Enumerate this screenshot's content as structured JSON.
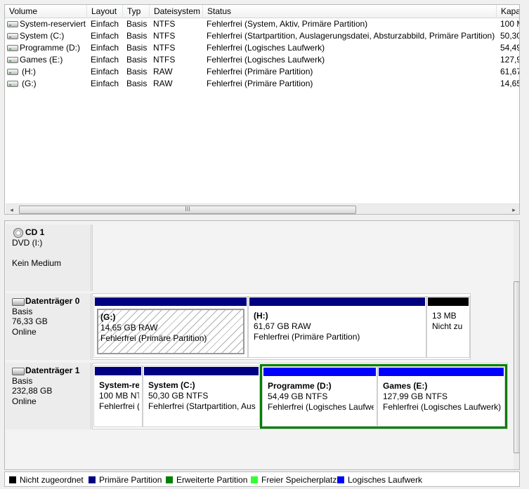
{
  "volume_list": {
    "columns": [
      "Volume",
      "Layout",
      "Typ",
      "Dateisystem",
      "Status",
      "Kapaz"
    ],
    "rows": [
      {
        "volume": "System-reserviert",
        "layout": "Einfach",
        "typ": "Basis",
        "fs": "NTFS",
        "status": "Fehlerfrei (System, Aktiv, Primäre Partition)",
        "kap": "100 M"
      },
      {
        "volume": "System (C:)",
        "layout": "Einfach",
        "typ": "Basis",
        "fs": "NTFS",
        "status": "Fehlerfrei (Startpartition, Auslagerungsdatei, Absturzabbild, Primäre Partition)",
        "kap": "50,30"
      },
      {
        "volume": "Programme (D:)",
        "layout": "Einfach",
        "typ": "Basis",
        "fs": "NTFS",
        "status": "Fehlerfrei (Logisches Laufwerk)",
        "kap": "54,49"
      },
      {
        "volume": "Games (E:)",
        "layout": "Einfach",
        "typ": "Basis",
        "fs": "NTFS",
        "status": "Fehlerfrei (Logisches Laufwerk)",
        "kap": "127,9"
      },
      {
        "volume": "(H:)",
        "layout": "Einfach",
        "typ": "Basis",
        "fs": "RAW",
        "status": "Fehlerfrei (Primäre Partition)",
        "kap": "61,67"
      },
      {
        "volume": "(G:)",
        "layout": "Einfach",
        "typ": "Basis",
        "fs": "RAW",
        "status": "Fehlerfrei (Primäre Partition)",
        "kap": "14,65"
      }
    ],
    "scroll_left_glyph": "◂",
    "scroll_right_glyph": "▸",
    "scroll_grip": "III"
  },
  "disks": {
    "cd1": {
      "name": "CD 1",
      "drive": "DVD (I:)",
      "state": "Kein Medium"
    },
    "disk0": {
      "name": "Datenträger 0",
      "type": "Basis",
      "size": "76,33 GB",
      "status": "Online",
      "partitions": [
        {
          "name": "(G:)",
          "size": "14,65 GB RAW",
          "status": "Fehlerfrei (Primäre Partition)"
        },
        {
          "name": "(H:)",
          "size": "61,67 GB RAW",
          "status": "Fehlerfrei (Primäre Partition)"
        },
        {
          "name": "",
          "size": "13 MB",
          "status": "Nicht zu"
        }
      ]
    },
    "disk1": {
      "name": "Datenträger 1",
      "type": "Basis",
      "size": "232,88 GB",
      "status": "Online",
      "partitions": [
        {
          "name": "System-re",
          "size": "100 MB NTI",
          "status": "Fehlerfrei ("
        },
        {
          "name": "System  (C:)",
          "size": "50,30 GB NTFS",
          "status": "Fehlerfrei (Startpartition, Aus"
        },
        {
          "name": "Programme  (D:)",
          "size": "54,49 GB NTFS",
          "status": "Fehlerfrei (Logisches Laufwe"
        },
        {
          "name": "Games  (E:)",
          "size": "127,99 GB NTFS",
          "status": "Fehlerfrei (Logisches Laufwerk)"
        }
      ]
    }
  },
  "legend": [
    {
      "label": "Nicht zugeordnet",
      "color": "#000000"
    },
    {
      "label": "Primäre Partition",
      "color": "#000080"
    },
    {
      "label": "Erweiterte Partition",
      "color": "#008000"
    },
    {
      "label": "Freier Speicherplatz",
      "color": "#33ff33"
    },
    {
      "label": "Logisches Laufwerk",
      "color": "#0000ff"
    }
  ],
  "colors": {
    "unallocated": "#000000",
    "primary": "#000080",
    "extended": "#008000",
    "free": "#33ff33",
    "logical": "#0000ff"
  }
}
